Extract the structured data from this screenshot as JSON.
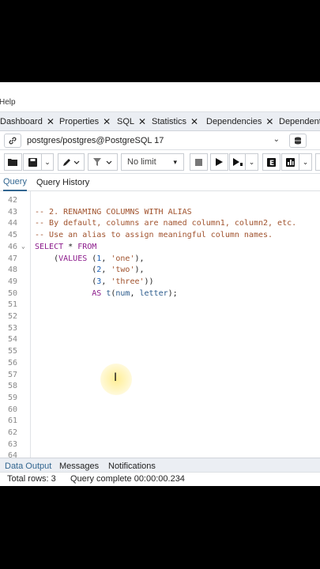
{
  "menubar": {
    "help_label": "Help"
  },
  "tabs": [
    {
      "label": "Dashboard"
    },
    {
      "label": "Properties"
    },
    {
      "label": "SQL"
    },
    {
      "label": "Statistics"
    },
    {
      "label": "Dependencies"
    },
    {
      "label": "Dependents"
    }
  ],
  "connection": {
    "label": "postgres/postgres@PostgreSQL 17"
  },
  "toolbar": {
    "limit_value": "No limit"
  },
  "query_tabs": [
    {
      "label": "Query",
      "active": true
    },
    {
      "label": "Query History",
      "active": false
    }
  ],
  "editor": {
    "lines": [
      {
        "n": "42",
        "text": ""
      },
      {
        "n": "43",
        "text": "-- 2. RENAMING COLUMNS WITH ALIAS"
      },
      {
        "n": "44",
        "text": "-- By default, columns are named column1, column2, etc."
      },
      {
        "n": "45",
        "text": "-- Use an alias to assign meaningful column names."
      },
      {
        "n": "46",
        "text": "SELECT * FROM"
      },
      {
        "n": "47",
        "text": "    (VALUES (1, 'one'),"
      },
      {
        "n": "48",
        "text": "            (2, 'two'),"
      },
      {
        "n": "49",
        "text": "            (3, 'three'))"
      },
      {
        "n": "50",
        "text": "            AS t(num, letter);"
      },
      {
        "n": "51",
        "text": ""
      },
      {
        "n": "52",
        "text": ""
      },
      {
        "n": "53",
        "text": ""
      },
      {
        "n": "54",
        "text": ""
      },
      {
        "n": "55",
        "text": ""
      },
      {
        "n": "56",
        "text": ""
      },
      {
        "n": "57",
        "text": ""
      },
      {
        "n": "58",
        "text": ""
      },
      {
        "n": "59",
        "text": ""
      },
      {
        "n": "60",
        "text": ""
      },
      {
        "n": "61",
        "text": ""
      },
      {
        "n": "62",
        "text": ""
      },
      {
        "n": "63",
        "text": ""
      },
      {
        "n": "64",
        "text": ""
      }
    ]
  },
  "bottom_tabs": [
    {
      "label": "Data Output",
      "active": true
    },
    {
      "label": "Messages",
      "active": false
    },
    {
      "label": "Notifications",
      "active": false
    }
  ],
  "status": {
    "total_rows": "Total rows: 3",
    "query_status": "Query complete 00:00:00.234"
  },
  "colors": {
    "accent": "#326690",
    "comment": "#a0522d",
    "keyword": "#8b1a8b",
    "number": "#1a5fb4"
  },
  "icons": [
    "link-icon",
    "database-icon",
    "folder-open-icon",
    "save-icon",
    "edit-pen-icon",
    "filter-icon",
    "stop-icon",
    "play-icon",
    "play-step-icon",
    "explain-icon",
    "chart-icon"
  ]
}
